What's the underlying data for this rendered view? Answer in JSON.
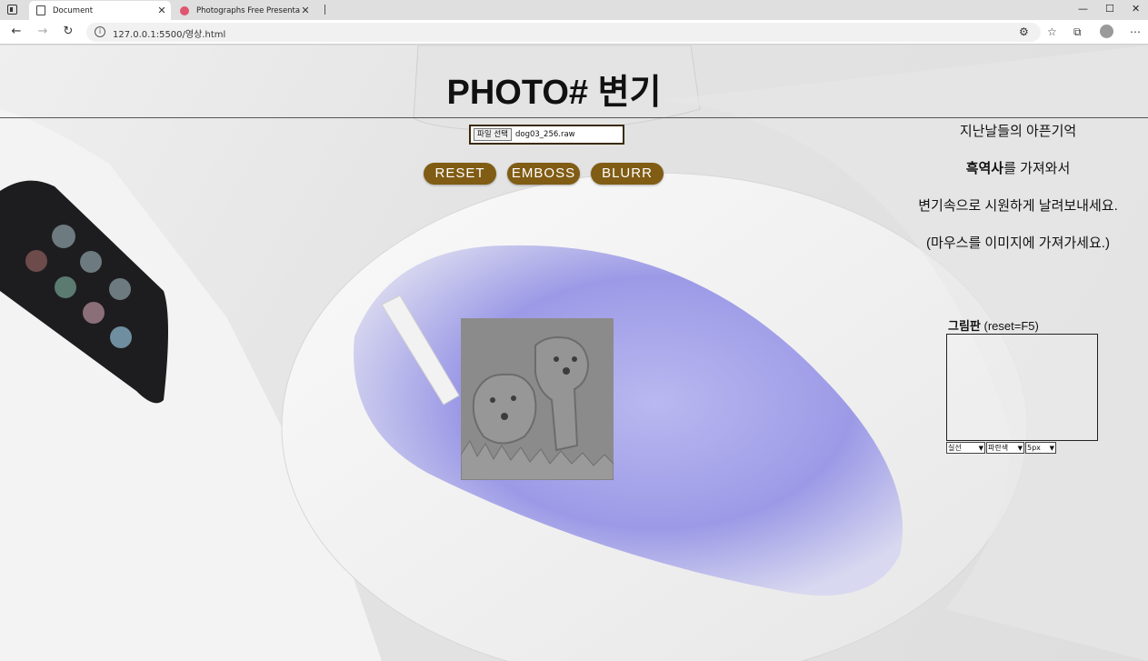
{
  "browser": {
    "tabs": [
      {
        "title": "Document",
        "active": true
      },
      {
        "title": "Photographs Free Presentation ...",
        "active": false
      }
    ],
    "url": "127.0.0.1:5500/영상.html",
    "icons": [
      "tab-actions-icon",
      "back-icon",
      "forward-icon",
      "refresh-icon",
      "info-icon",
      "extension-icon",
      "favorites-icon",
      "collections-icon",
      "profile-icon",
      "menu-icon"
    ]
  },
  "page": {
    "heading": "PHOTO# 변기",
    "file_button": "파일 선택",
    "file_name": "dog03_256.raw",
    "buttons": {
      "reset": "RESET",
      "emboss": "EMBOSS",
      "blur": "BLURR"
    },
    "side_lines": [
      "지난날들의 아픈기억",
      "흑역사를 가져와서",
      "변기속으로 시원하게 날려보내세요.",
      "(마우스를 이미지에 가져가세요.)"
    ],
    "side_bold": "흑역사",
    "canvas": {
      "label_bold": "그림판",
      "label_rest": " (reset=F5)",
      "selects": [
        "실선",
        "파란색",
        "5px"
      ]
    }
  },
  "colors": {
    "accent": "#805c14",
    "accent_border": "#3a2b05"
  }
}
